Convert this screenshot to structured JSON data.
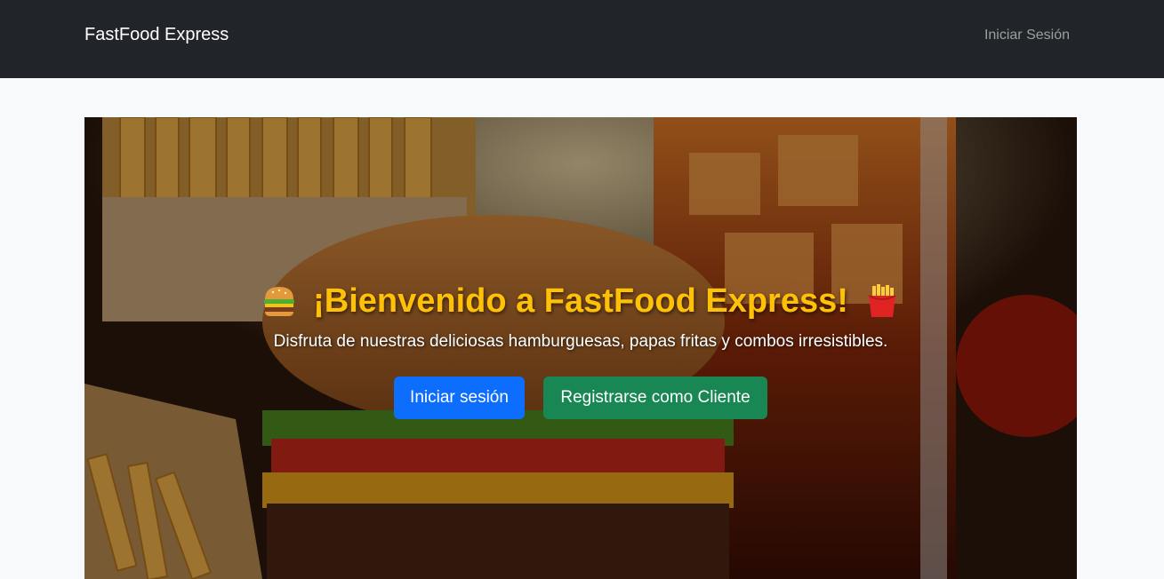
{
  "navbar": {
    "brand": "FastFood Express",
    "login_link": "Iniciar Sesión"
  },
  "hero": {
    "title": "¡Bienvenido a FastFood Express!",
    "left_emoji_icon": "hamburger-icon",
    "right_emoji_icon": "french-fries-icon",
    "subtitle": "Disfruta de nuestras deliciosas hamburguesas, papas fritas y combos irresistibles.",
    "login_button": "Iniciar sesión",
    "register_button": "Registrarse como Cliente"
  },
  "colors": {
    "navbar_bg": "#212529",
    "title": "#ffc107",
    "primary": "#0d6efd",
    "success": "#198754",
    "page_bg": "#f8f9fa"
  }
}
